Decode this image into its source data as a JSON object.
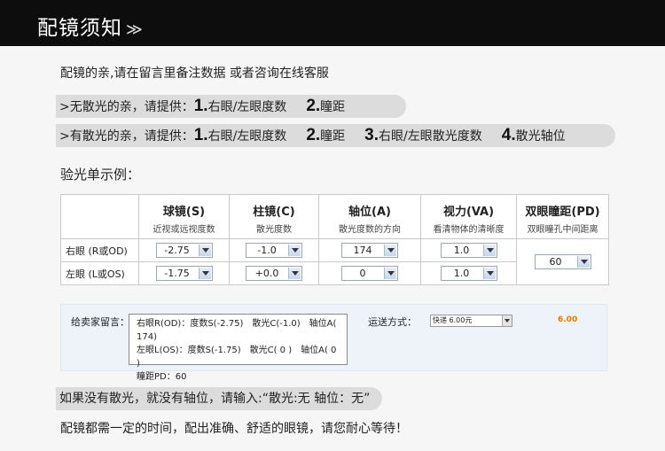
{
  "header": {
    "title": "配镜须知",
    "arrows": "≫"
  },
  "intro": "配镜的亲,请在留言里备注数据 或者咨询在线客服",
  "no_astig": {
    "lead": ">无散光的亲，请提供：",
    "items": [
      {
        "num": "1.",
        "text": "右眼/左眼度数"
      },
      {
        "num": "2.",
        "text": "瞳距"
      }
    ]
  },
  "with_astig": {
    "lead": ">有散光的亲，请提供：",
    "items": [
      {
        "num": "1.",
        "text": "右眼/左眼度数"
      },
      {
        "num": "2.",
        "text": "瞳距"
      },
      {
        "num": "3.",
        "text": "右眼/左眼散光度数"
      },
      {
        "num": "4.",
        "text": "散光轴位"
      }
    ]
  },
  "example_label": "验光单示例：",
  "table": {
    "columns": [
      {
        "title": "球镜(S)",
        "sub": "近视或远视度数"
      },
      {
        "title": "柱镜(C)",
        "sub": "散光度数"
      },
      {
        "title": "轴位(A)",
        "sub": "散光度数的方向"
      },
      {
        "title": "视力(VA)",
        "sub": "看清物体的清晰度"
      },
      {
        "title": "双眼瞳距(PD)",
        "sub": "双眼瞳孔中间距离"
      }
    ],
    "rows": [
      {
        "label": "右眼 (R或OD)",
        "sphere": "-2.75",
        "cyl": "-1.0",
        "axis": "174",
        "va": "1.0"
      },
      {
        "label": "左眼 (L或OS)",
        "sphere": "-1.75",
        "cyl": "+0.0",
        "axis": "0",
        "va": "1.0"
      }
    ],
    "pd": "60"
  },
  "order": {
    "message_label": "给卖家留言：",
    "message_lines": [
      [
        "右眼R(OD)：度数S(-2.75)",
        "散光C(-1.0)",
        "轴位A( 174)"
      ],
      [
        "左眼L(OS)：度数S(-1.75)",
        "散光C( 0 )",
        "轴位A( 0 )"
      ],
      [
        "瞳距PD：60"
      ]
    ],
    "shipping_label": "运送方式：",
    "shipping_value": "快递 6.00元",
    "price": "6.00"
  },
  "note": "如果没有散光，就没有轴位，请输入:“散光:无    轴位：无”",
  "closing": "配镜都需一定的时间，配出准确、舒适的眼镜，请您耐心等待！"
}
